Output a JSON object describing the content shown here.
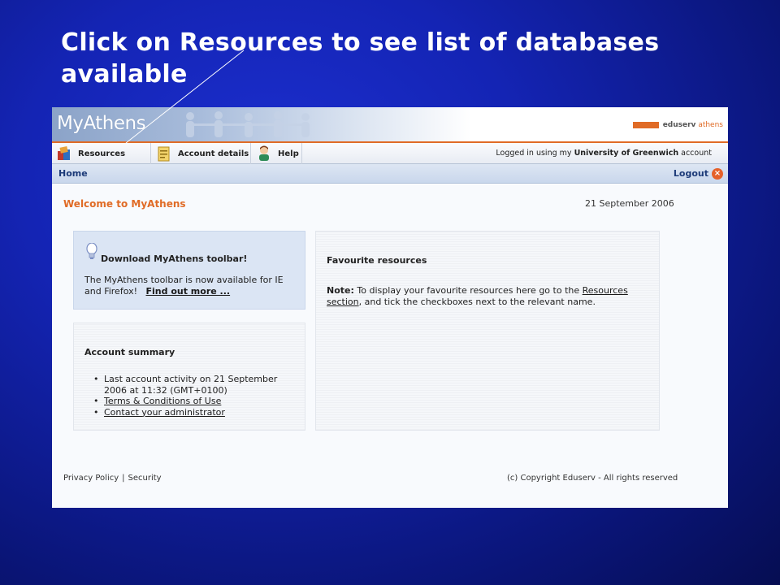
{
  "slide": {
    "title": "Click on Resources to see list of databases available"
  },
  "banner": {
    "brand": "MyAthens",
    "partner_name_part1": "eduserv",
    "partner_name_part2": "athens"
  },
  "nav": {
    "tabs": [
      {
        "label": "Resources",
        "icon": "resources-icon"
      },
      {
        "label": "Account details",
        "icon": "account-details-icon"
      },
      {
        "label": "Help",
        "icon": "help-icon"
      }
    ],
    "logged_in_prefix": "Logged in using my",
    "institution": "University of Greenwich",
    "logged_in_suffix": "account"
  },
  "subnav": {
    "home": "Home",
    "logout": "Logout"
  },
  "main": {
    "welcome": "Welcome to MyAthens",
    "date": "21 September 2006",
    "toolbar_panel": {
      "title": "Download MyAthens toolbar!",
      "text": "The MyAthens toolbar is now available for IE and Firefox!",
      "link": "Find out more ..."
    },
    "favourites_panel": {
      "title": "Favourite resources",
      "note_label": "Note:",
      "note_text": "To display your favourite resources here go to the",
      "note_link": "Resources section",
      "note_text_end": ", and tick the checkboxes next to the relevant name."
    },
    "account_panel": {
      "title": "Account summary",
      "activity": "Last account activity on 21 September 2006 at 11:32 (GMT+0100)",
      "terms_link": "Terms & Conditions of Use",
      "contact_link": "Contact your administrator"
    }
  },
  "footer": {
    "privacy": "Privacy Policy",
    "separator": "|",
    "security": "Security",
    "copyright": "(c) Copyright Eduserv - All rights reserved"
  },
  "colors": {
    "accent": "#e06b26",
    "slide_bg": "#1424b4",
    "link_blue": "#1c3a78"
  }
}
